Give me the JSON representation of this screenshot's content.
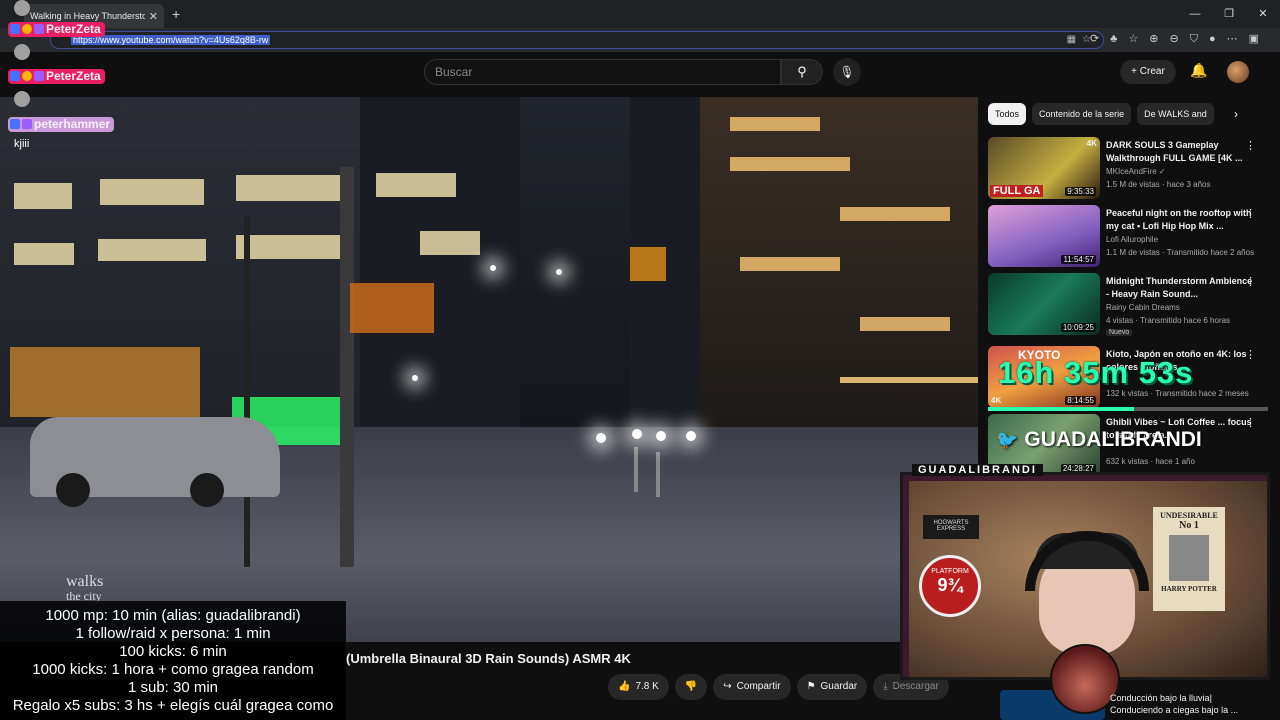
{
  "browser": {
    "tab_title": "Walking in Heavy Thunderstorm",
    "tab_close": "✕",
    "new_tab": "+",
    "url": "https://www.youtube.com/watch?v=4Us62q8B-rw",
    "window_controls": [
      "—",
      "❐",
      "✕"
    ]
  },
  "youtube": {
    "search_placeholder": "Buscar",
    "create_label": "Crear",
    "video_title": "(Umbrella Binaural 3D Rain Sounds) ASMR 4K",
    "watermark_line1": "walks",
    "watermark_line2": "the city",
    "actions": {
      "likes": "7.8 K",
      "share": "Compartir",
      "save": "Guardar",
      "download": "Descargar"
    },
    "chips": [
      "Todos",
      "Contenido de la serie",
      "De WALKS and"
    ],
    "recommendations": [
      {
        "title": "DARK SOULS 3 Gameplay Walkthrough FULL GAME [4K ...",
        "channel": "MKIceAndFire ✓",
        "meta": "1.5 M de vistas · hace 3 años",
        "duration": "9:35:33",
        "thumb_label": "FULL GA",
        "badge": "",
        "quality": "4K"
      },
      {
        "title": "Peaceful night on the rooftop with my cat • Lofi Hip Hop Mix ...",
        "channel": "Lofi Ailurophile",
        "meta": "1.1 M de vistas · Transmitido hace 2 años",
        "duration": "11:54:57",
        "thumb_label": "",
        "badge": "",
        "quality": ""
      },
      {
        "title": "Midnight Thunderstorm Ambience - Heavy Rain Sound...",
        "channel": "Rainy Cabin Dreams",
        "meta": "4 vistas · Transmitido hace 6 horas",
        "duration": "10:09:25",
        "thumb_label": "",
        "badge": "Nuevo",
        "quality": ""
      },
      {
        "title": "Kioto, Japón en otoño en 4K: los colores otoñales...",
        "channel": "",
        "meta": "132 k vistas · Transmitido hace 2 meses",
        "duration": "8:14:55",
        "thumb_label": "KYOTO",
        "badge": "",
        "quality": "4K"
      },
      {
        "title": "Ghibli Vibes ~ Lofi Coffee ... focus to study / rela...",
        "channel": "",
        "meta": "632 k vistas · hace 1 año",
        "duration": "24:28:27",
        "thumb_label": "",
        "badge": "",
        "quality": ""
      }
    ],
    "bottom_rec_line1": "Conducción bajo la lluvia|",
    "bottom_rec_line2": "Conduciendo a ciegas bajo la ..."
  },
  "stream_overlay": {
    "chat": [
      {
        "user": "PeterZeta",
        "color": "#e91e63"
      },
      {
        "user": "PeterZeta",
        "color": "#e91e63"
      },
      {
        "user": "peterhammer",
        "color": "#c89bd8"
      }
    ],
    "chat_message": "kjiii",
    "rules": [
      "1000 mp: 10 min (alias: guadalibrandi)",
      "1 follow/raid x persona: 1 min",
      "100 kicks: 6 min",
      "1000 kicks: 1 hora + como gragea random",
      "1 sub: 30 min",
      "Regalo x5 subs: 3 hs + elegís cuál gragea como"
    ],
    "timer": "16h 35m 53s",
    "timer_progress": 0.52,
    "twitter_handle": "GUADALIBRANDI",
    "cam_label": "GUADALIBRANDI",
    "poster_title": "UNDESIRABLE",
    "poster_no": "No 1",
    "poster_name": "HARRY POTTER",
    "platform_label": "PLATFORM",
    "platform_number": "9¾",
    "hogwarts_label": "HOGWARTS EXPRESS"
  },
  "colors": {
    "accent": "#3d5fc7",
    "timer": "#2affb0",
    "chat_user": "#e91e63"
  }
}
